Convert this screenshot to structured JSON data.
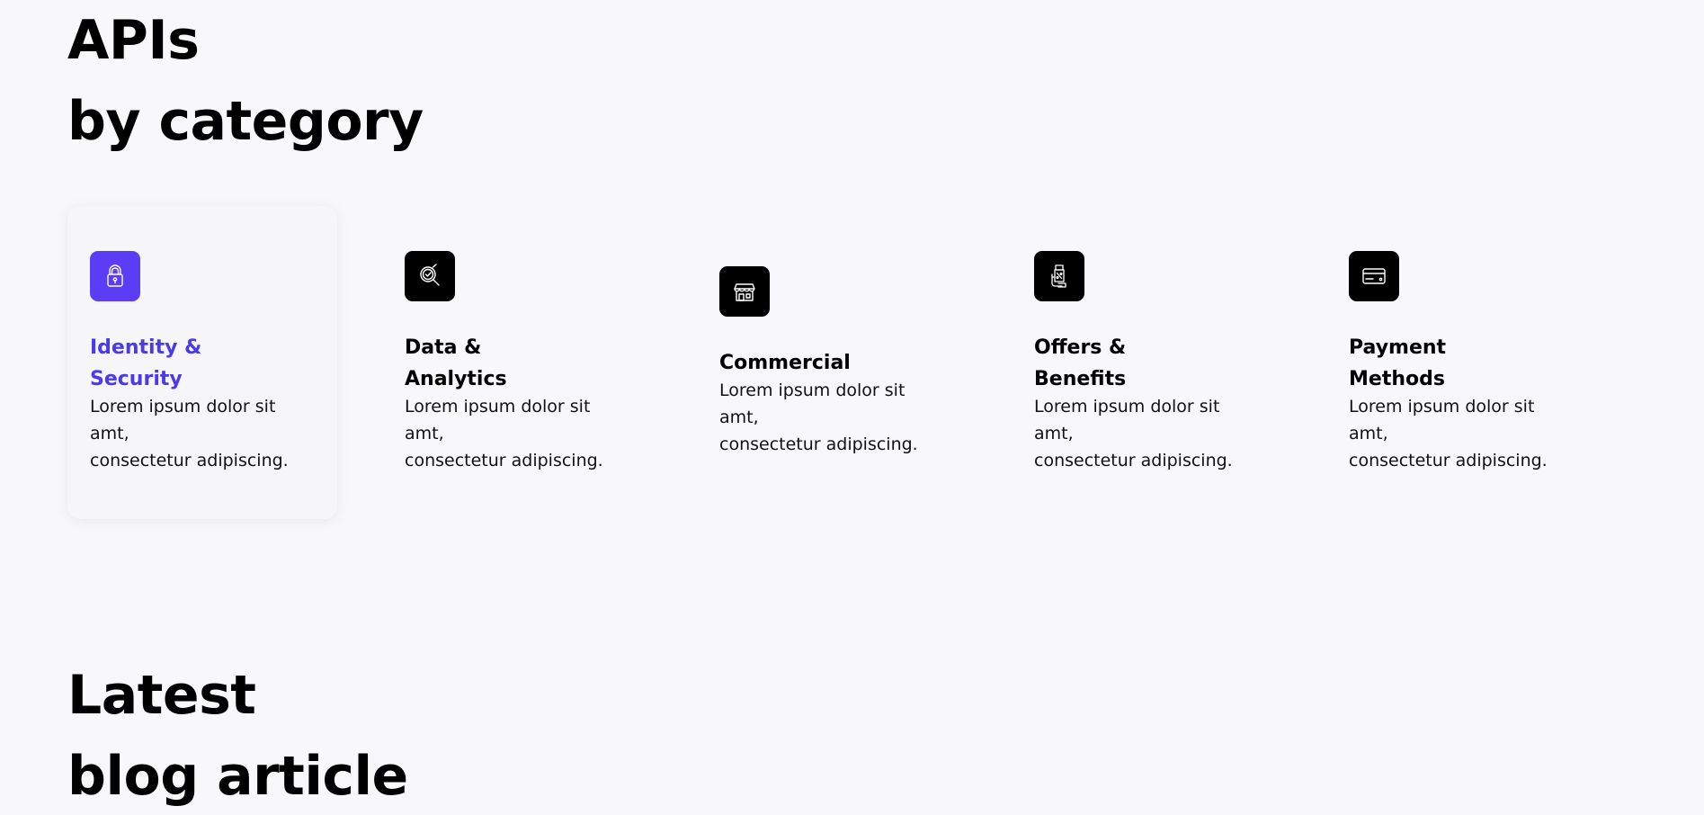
{
  "apis_section": {
    "title_line1": "APIs",
    "title_line2": "by category"
  },
  "categories": [
    {
      "title_line1": "Identity &",
      "title_line2": "Security",
      "desc_line1": "Lorem ipsum dolor sit",
      "desc_line2": "amt,",
      "desc_line3": "consectetur adipiscing.",
      "icon": "lock-icon",
      "active": true
    },
    {
      "title_line1": "Data &",
      "title_line2": "Analytics",
      "desc_line1": "Lorem ipsum dolor sit",
      "desc_line2": "amt,",
      "desc_line3": "consectetur adipiscing.",
      "icon": "analytics-search-icon",
      "active": false
    },
    {
      "title_line1": "Commercial",
      "title_line2": "",
      "desc_line1": "Lorem ipsum dolor sit",
      "desc_line2": "amt,",
      "desc_line3": "consectetur adipiscing.",
      "icon": "storefront-icon",
      "active": false
    },
    {
      "title_line1": "Offers &",
      "title_line2": "Benefits",
      "desc_line1": "Lorem ipsum dolor sit",
      "desc_line2": "amt,",
      "desc_line3": "consectetur adipiscing.",
      "icon": "discount-coupon-icon",
      "active": false
    },
    {
      "title_line1": "Payment",
      "title_line2": "Methods",
      "desc_line1": "Lorem ipsum dolor sit",
      "desc_line2": "amt,",
      "desc_line3": "consectetur adipiscing.",
      "icon": "credit-card-icon",
      "active": false
    }
  ],
  "blog_section": {
    "title_line1": "Latest",
    "title_line2": "blog article"
  },
  "colors": {
    "background": "#f8f8fa",
    "accent": "#5b3df5",
    "accent_text": "#4b3ae8",
    "icon_bg": "#000000"
  }
}
